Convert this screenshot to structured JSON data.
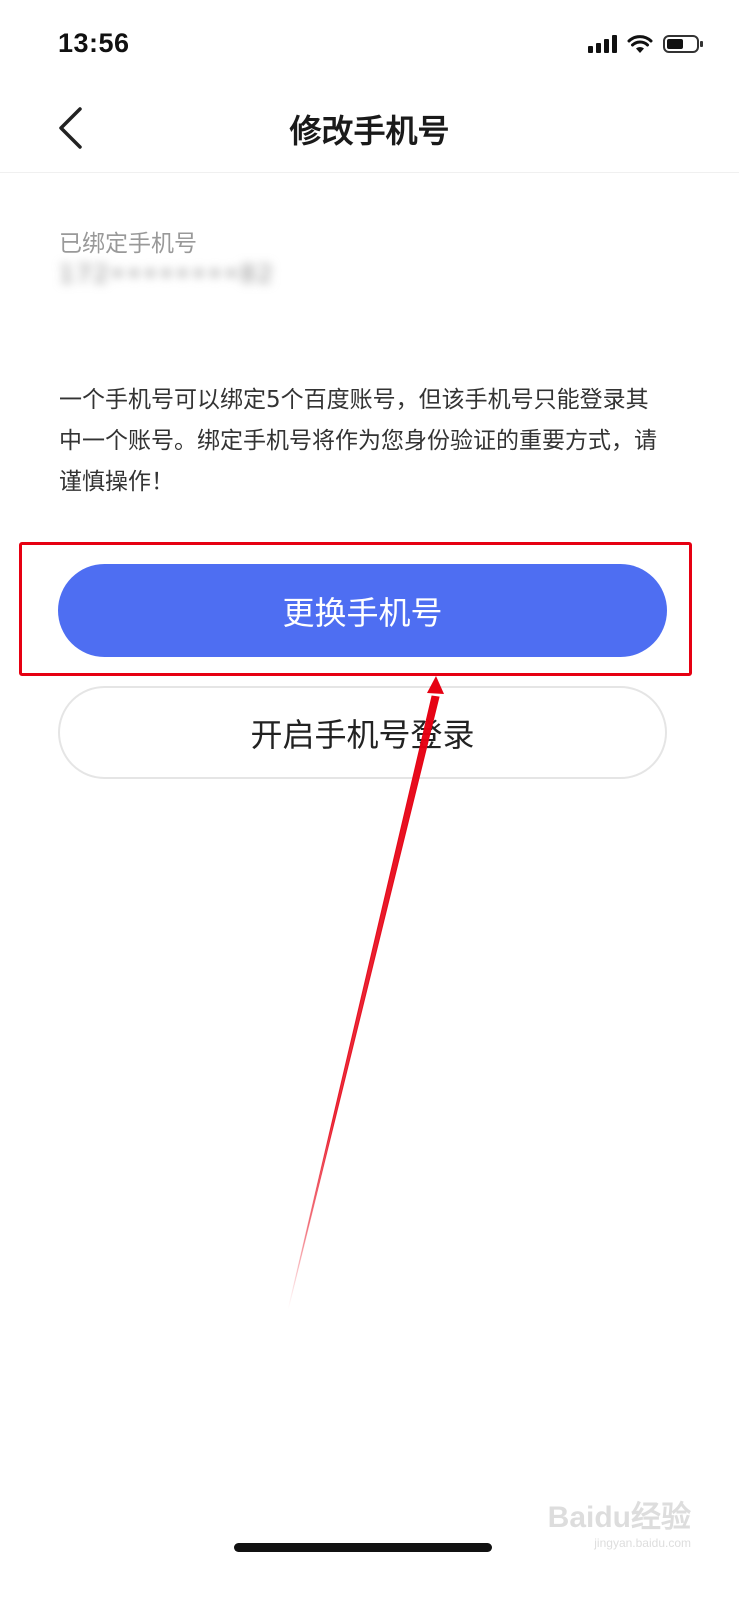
{
  "status_bar": {
    "time": "13:56"
  },
  "header": {
    "title": "修改手机号",
    "back_icon": "chevron-left-icon"
  },
  "bound_phone": {
    "label": "已绑定手机号",
    "value": "172••••••••82"
  },
  "notice": {
    "text": "一个手机号可以绑定5个百度账号，但该手机号只能登录其中一个账号。绑定手机号将作为您身份验证的重要方式，请谨慎操作！"
  },
  "buttons": {
    "change_phone": "更换手机号",
    "enable_phone_login": "开启手机号登录"
  },
  "watermark": {
    "brand": "Baidu经验",
    "url": "jingyan.baidu.com"
  },
  "colors": {
    "primary": "#4e6ef2",
    "highlight": "#e60012"
  }
}
